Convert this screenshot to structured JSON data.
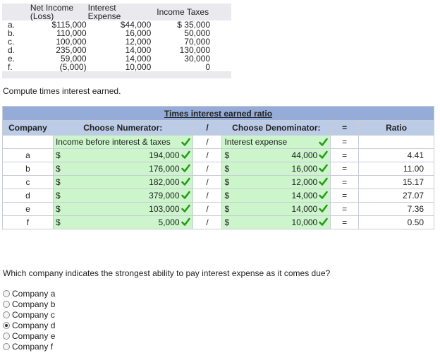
{
  "given": {
    "headers": [
      "Net Income (Loss)",
      "Interest Expense",
      "Income Taxes"
    ],
    "rows": [
      {
        "label": "a.",
        "net": "$115,000",
        "interest": "$44,000",
        "taxes": "$ 35,000"
      },
      {
        "label": "b.",
        "net": "110,000",
        "interest": "16,000",
        "taxes": "50,000"
      },
      {
        "label": "c.",
        "net": "100,000",
        "interest": "12,000",
        "taxes": "70,000"
      },
      {
        "label": "d.",
        "net": "235,000",
        "interest": "14,000",
        "taxes": "130,000"
      },
      {
        "label": "e.",
        "net": "59,000",
        "interest": "14,000",
        "taxes": "30,000"
      },
      {
        "label": "f.",
        "net": "(5,000)",
        "interest": "10,000",
        "taxes": "0"
      }
    ]
  },
  "instruction": "Compute times interest earned.",
  "ratio_table": {
    "title": "Times interest earned ratio",
    "headers": {
      "company": "Company",
      "numerator": "Choose Numerator:",
      "slash": "/",
      "denominator": "Choose Denominator:",
      "equals": "=",
      "ratio": "Ratio"
    },
    "label_row": {
      "numerator": "Income before interest & taxes",
      "slash": "/",
      "denominator": "Interest expense",
      "equals": "="
    },
    "currency": "$",
    "rows": [
      {
        "company": "a",
        "numerator": "194,000",
        "slash": "/",
        "denominator": "44,000",
        "equals": "=",
        "ratio": "4.41"
      },
      {
        "company": "b",
        "numerator": "176,000",
        "slash": "/",
        "denominator": "16,000",
        "equals": "=",
        "ratio": "11.00"
      },
      {
        "company": "c",
        "numerator": "182,000",
        "slash": "/",
        "denominator": "12,000",
        "equals": "=",
        "ratio": "15.17"
      },
      {
        "company": "d",
        "numerator": "379,000",
        "slash": "/",
        "denominator": "14,000",
        "equals": "=",
        "ratio": "27.07"
      },
      {
        "company": "e",
        "numerator": "103,000",
        "slash": "/",
        "denominator": "14,000",
        "equals": "=",
        "ratio": "7.36"
      },
      {
        "company": "f",
        "numerator": "5,000",
        "slash": "/",
        "denominator": "10,000",
        "equals": "=",
        "ratio": "0.50"
      }
    ],
    "check_color": "#2a9a1a"
  },
  "question": "Which company indicates the strongest ability to pay interest expense as it comes due?",
  "options": [
    "Company a",
    "Company b",
    "Company c",
    "Company d",
    "Company e",
    "Company f"
  ],
  "selected_option": "Company d"
}
